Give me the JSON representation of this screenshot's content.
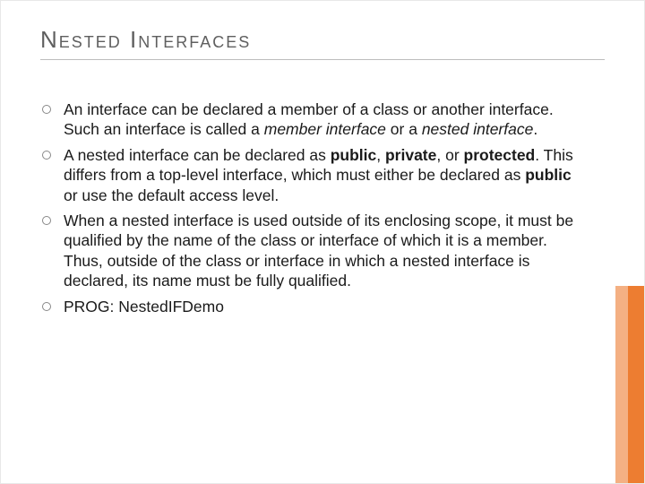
{
  "title": "Nested Interfaces",
  "bullets": [
    {
      "segments": [
        {
          "text": "An interface can be declared a member of a class or another interface. Such an interface is called a "
        },
        {
          "text": "member interface",
          "style": "i"
        },
        {
          "text": " or a "
        },
        {
          "text": "nested interface",
          "style": "i"
        },
        {
          "text": "."
        }
      ]
    },
    {
      "segments": [
        {
          "text": "A nested interface can be declared as "
        },
        {
          "text": "public",
          "style": "b"
        },
        {
          "text": ", "
        },
        {
          "text": "private",
          "style": "b"
        },
        {
          "text": ", or "
        },
        {
          "text": "protected",
          "style": "b"
        },
        {
          "text": ". This differs from a top-level interface, which must either be declared as "
        },
        {
          "text": "public",
          "style": "b"
        },
        {
          "text": " or use the default access level."
        }
      ]
    },
    {
      "segments": [
        {
          "text": "When a nested interface is used outside of its enclosing scope, it must be qualified by the name of the class or interface of which it is a member. Thus, outside of the class or interface in which a nested interface is declared, its name must be fully qualified."
        }
      ]
    },
    {
      "segments": [
        {
          "text": "PROG: NestedIFDemo"
        }
      ]
    }
  ]
}
